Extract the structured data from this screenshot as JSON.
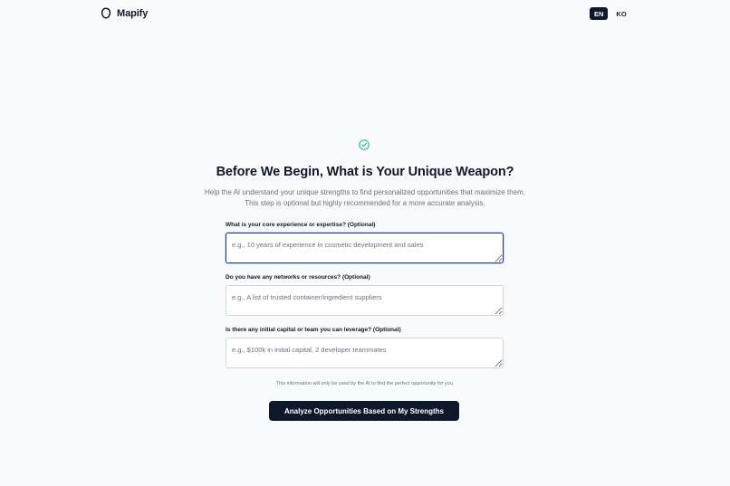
{
  "header": {
    "brand_name": "Mapify",
    "languages": [
      {
        "label": "EN",
        "active": true
      },
      {
        "label": "KO",
        "active": false
      }
    ]
  },
  "main": {
    "title": "Before We Begin, What is Your Unique Weapon?",
    "subtitle_line1": "Help the AI understand your unique strengths to find personalized opportunities that maximize them.",
    "subtitle_line2": "This step is optional but highly recommended for a more accurate analysis.",
    "fields": [
      {
        "label": "What is your core experience or expertise? (Optional)",
        "placeholder": "e.g., 10 years of experience in cosmetic development and sales",
        "value": ""
      },
      {
        "label": "Do you have any networks or resources? (Optional)",
        "placeholder": "e.g., A list of trusted container/ingredient suppliers",
        "value": ""
      },
      {
        "label": "Is there any initial capital or team you can leverage? (Optional)",
        "placeholder": "e.g., $100k in initial capital, 2 developer teammates",
        "value": ""
      }
    ],
    "note": "This information will only be used by the AI to find the perfect opportunity for you.",
    "submit_label": "Analyze Opportunities Based on My Strengths"
  },
  "colors": {
    "background": "#f9fafb",
    "primary": "#0f172a",
    "success": "#10b981",
    "muted_text": "#6b7280"
  },
  "icons": {
    "brand": "map-pin-icon",
    "status": "check-circle-icon"
  }
}
